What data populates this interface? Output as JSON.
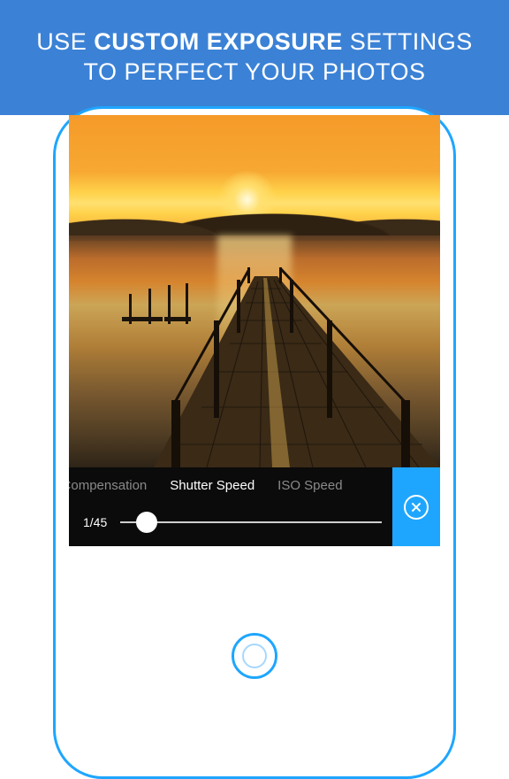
{
  "banner": {
    "line1_pre": "USE ",
    "line1_bold": "CUSTOM EXPOSURE",
    "line1_post": " SETTINGS",
    "line2": "TO PERFECT YOUR PHOTOS"
  },
  "tabs": {
    "compensation": "Exposure Compensation",
    "shutter": "Shutter Speed",
    "iso": "ISO Speed"
  },
  "slider": {
    "value_label": "1/45",
    "position_pct": 10
  },
  "colors": {
    "accent": "#1ea6ff",
    "banner": "#3b82d6"
  }
}
